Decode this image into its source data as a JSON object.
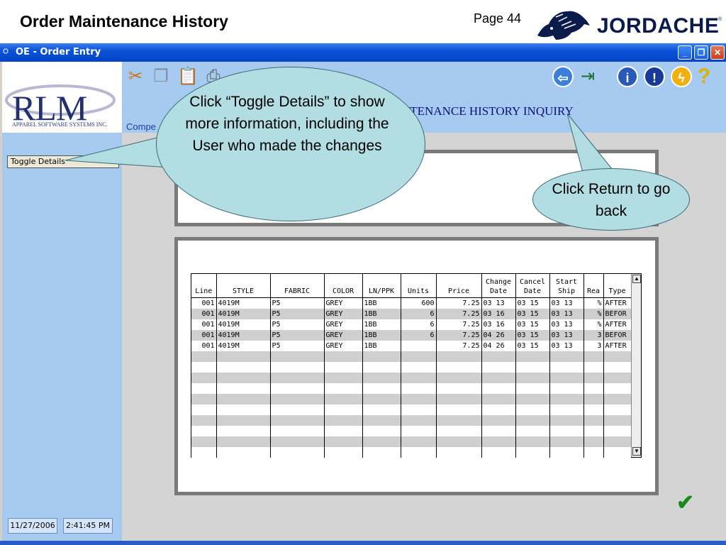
{
  "slide": {
    "title": "Order Maintenance History",
    "page": "Page 44",
    "brand": "JORDACHE",
    "brand_reg": "®"
  },
  "window": {
    "title": "OE - Order Entry",
    "buttons": {
      "minimize": "_",
      "restore": "❐",
      "close": "✕"
    }
  },
  "sidebar": {
    "logo_text": "RLM",
    "logo_sub": "APPAREL SOFTWARE SYSTEMS INC.",
    "toggle_label": "Toggle Details",
    "status_date": "11/27/2006",
    "status_time": "2:41:45 PM"
  },
  "toolbar": {
    "icons": [
      "scissors-icon",
      "copy-icon",
      "paste-icon",
      "print-icon"
    ],
    "right_icons": [
      "return-icon",
      "exit-icon",
      "info-icon",
      "alert-icon",
      "lightning-icon",
      "help-icon"
    ],
    "company_label": "Compe",
    "screen_title": "NTENANCE HISTORY INQUIRY"
  },
  "grid": {
    "headers": [
      [
        "",
        "Line"
      ],
      [
        "",
        "STYLE"
      ],
      [
        "",
        "FABRIC"
      ],
      [
        "",
        "COLOR"
      ],
      [
        "",
        "LN/PPK"
      ],
      [
        "",
        "Units"
      ],
      [
        "",
        "Price"
      ],
      [
        "Change",
        "Date"
      ],
      [
        "Cancel",
        "Date"
      ],
      [
        "Start",
        "Ship"
      ],
      [
        "",
        "Rea"
      ],
      [
        "",
        "Type"
      ]
    ],
    "rows": [
      [
        "001",
        "4019M",
        "P5",
        "GREY",
        "1BB",
        "600",
        "7.25",
        "03  13",
        "03  15",
        "03  13",
        "%",
        "AFTER"
      ],
      [
        "001",
        "4019M",
        "P5",
        "GREY",
        "1BB",
        "6",
        "7.25",
        "03  16",
        "03  15",
        "03  13",
        "%",
        "BEFOR"
      ],
      [
        "001",
        "4019M",
        "P5",
        "GREY",
        "1BB",
        "6",
        "7.25",
        "03  16",
        "03  15",
        "03  13",
        "%",
        "AFTER"
      ],
      [
        "001",
        "4019M",
        "P5",
        "GREY",
        "1BB",
        "6",
        "7.25",
        "04  26",
        "03  15",
        "03  13",
        "3",
        "BEFOR"
      ],
      [
        "001",
        "4019M",
        "P5",
        "GREY",
        "1BB",
        "",
        "7.25",
        "04  26",
        "03  15",
        "03  13",
        "3",
        "AFTER"
      ]
    ],
    "blank_rows": 10,
    "scroll_up": "▲",
    "scroll_down": "▼"
  },
  "callouts": {
    "toggle": "Click “Toggle Details” to show more information, including the User who made the changes",
    "return": "Click Return to go back"
  },
  "accept_symbol": "✔"
}
